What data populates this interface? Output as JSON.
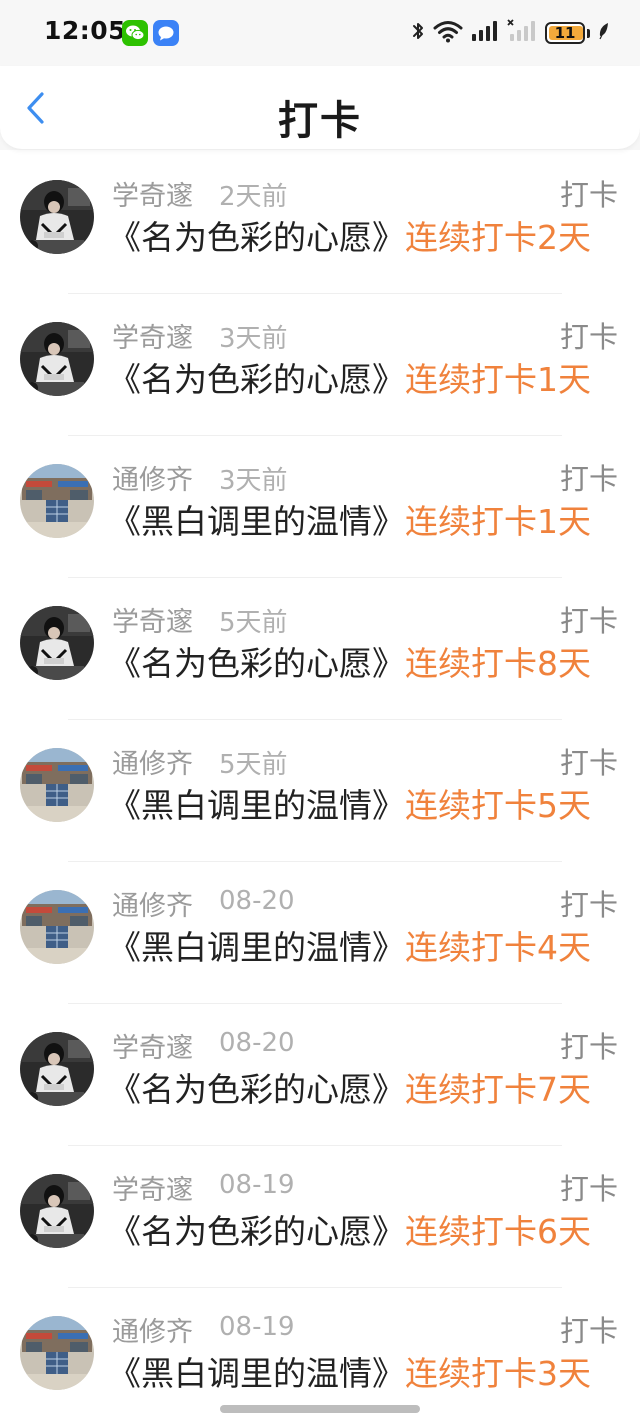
{
  "status_bar": {
    "time": "12:05",
    "battery": "11",
    "battery_level_percent": 11,
    "notification_icons": [
      "wechat-icon",
      "message-icon"
    ],
    "system_icons": [
      "bluetooth-icon",
      "wifi-icon",
      "signal-icon",
      "signal-no-service-icon",
      "battery-icon",
      "leaf-icon"
    ],
    "battery_accent_color": "#f2a93b"
  },
  "header": {
    "title": "打卡",
    "back_icon": "chevron-left-icon",
    "back_color": "#3d8ef0"
  },
  "colors": {
    "streak": "#f0823c",
    "meta": "#9b9b9b"
  },
  "items": [
    {
      "user": "学奇邃",
      "time": "2天前",
      "action": "打卡",
      "book": "《名为色彩的心愿》",
      "streak": "连续打卡2天",
      "avatar": "avatar-dark-photo"
    },
    {
      "user": "学奇邃",
      "time": "3天前",
      "action": "打卡",
      "book": "《名为色彩的心愿》",
      "streak": "连续打卡1天",
      "avatar": "avatar-dark-photo"
    },
    {
      "user": "通修齐",
      "time": "3天前",
      "action": "打卡",
      "book": "《黑白调里的温情》",
      "streak": "连续打卡1天",
      "avatar": "avatar-storefront-photo"
    },
    {
      "user": "学奇邃",
      "time": "5天前",
      "action": "打卡",
      "book": "《名为色彩的心愿》",
      "streak": "连续打卡8天",
      "avatar": "avatar-dark-photo"
    },
    {
      "user": "通修齐",
      "time": "5天前",
      "action": "打卡",
      "book": "《黑白调里的温情》",
      "streak": "连续打卡5天",
      "avatar": "avatar-storefront-photo"
    },
    {
      "user": "通修齐",
      "time": "08-20",
      "action": "打卡",
      "book": "《黑白调里的温情》",
      "streak": "连续打卡4天",
      "avatar": "avatar-storefront-photo"
    },
    {
      "user": "学奇邃",
      "time": "08-20",
      "action": "打卡",
      "book": "《名为色彩的心愿》",
      "streak": "连续打卡7天",
      "avatar": "avatar-dark-photo"
    },
    {
      "user": "学奇邃",
      "time": "08-19",
      "action": "打卡",
      "book": "《名为色彩的心愿》",
      "streak": "连续打卡6天",
      "avatar": "avatar-dark-photo"
    },
    {
      "user": "通修齐",
      "time": "08-19",
      "action": "打卡",
      "book": "《黑白调里的温情》",
      "streak": "连续打卡3天",
      "avatar": "avatar-storefront-photo"
    }
  ]
}
